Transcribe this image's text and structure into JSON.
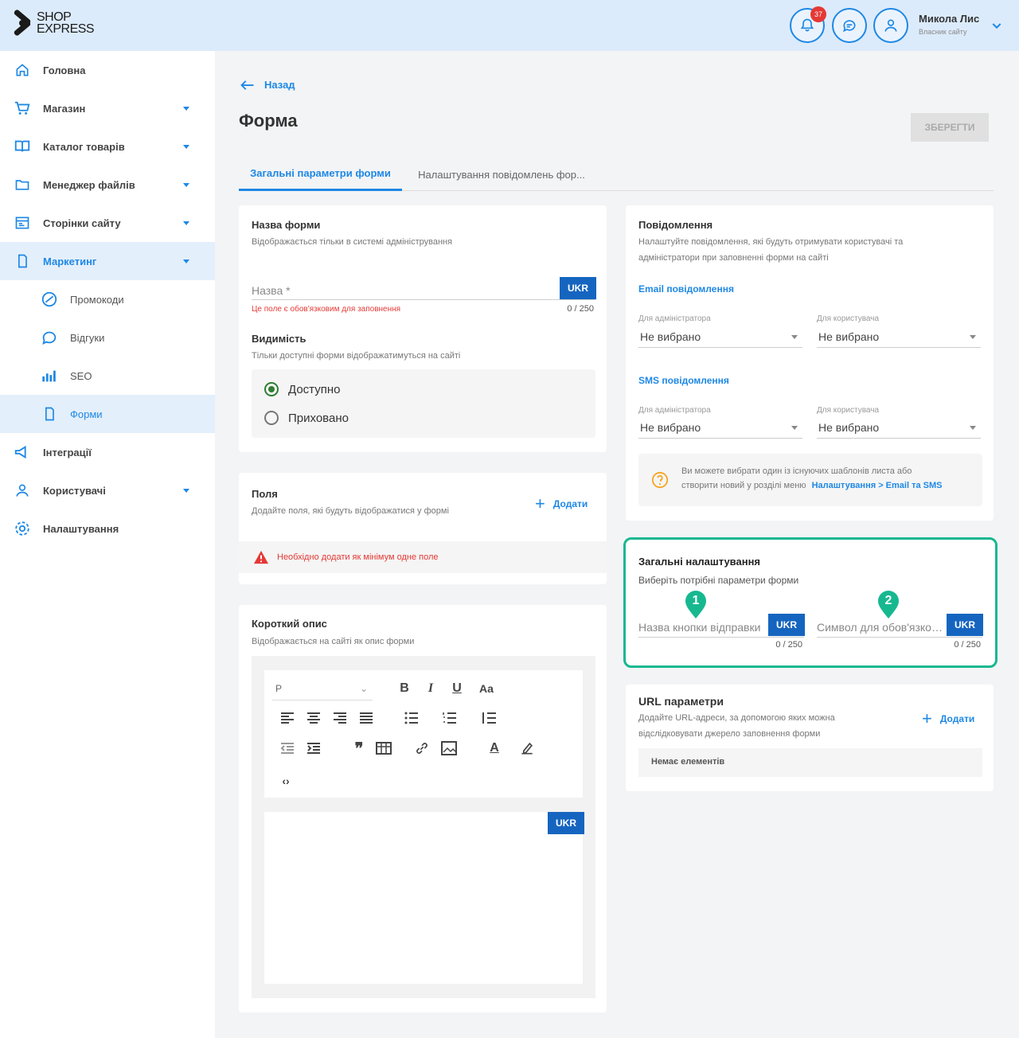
{
  "header": {
    "logo_line1": "SHOP",
    "logo_line2": "EXPRESS",
    "notifications_count": "37",
    "user_name": "Микола Лис",
    "user_role": "Власник сайту",
    "accent": "#1e88e5"
  },
  "sidebar": {
    "items": [
      {
        "label": "Головна",
        "icon": "home-icon"
      },
      {
        "label": "Магазин",
        "icon": "cart-icon"
      },
      {
        "label": "Каталог товарів",
        "icon": "book-icon"
      },
      {
        "label": "Менеджер файлів",
        "icon": "folder-icon"
      },
      {
        "label": "Сторінки сайту",
        "icon": "pages-icon"
      },
      {
        "label": "Маркетинг",
        "icon": "marketing-icon"
      },
      {
        "label": "Промокоди",
        "icon": "promo-icon"
      },
      {
        "label": "Відгуки",
        "icon": "review-icon"
      },
      {
        "label": "SEO",
        "icon": "seo-icon"
      },
      {
        "label": "Форми",
        "icon": "form-icon"
      },
      {
        "label": "Інтеграції",
        "icon": "integration-icon"
      },
      {
        "label": "Користувачі",
        "icon": "users-icon"
      },
      {
        "label": "Налаштування",
        "icon": "gear-icon"
      }
    ]
  },
  "page": {
    "back_label": "Назад",
    "title": "Форма",
    "save_label": "ЗБЕРЕГТИ",
    "tabs": [
      "Загальні параметри форми",
      "Налаштування повідомлень фор..."
    ]
  },
  "form_name": {
    "title": "Назва форми",
    "subtitle": "Відображається тільки в системі адміністрування",
    "placeholder": "Назва *",
    "lang": "UKR",
    "error": "Це поле є обов'язковим для заповнення",
    "counter": "0 / 250",
    "visibility_title": "Видимість",
    "visibility_subtitle": "Тільки доступні форми відображатимуться на сайті",
    "option_available": "Доступно",
    "option_hidden": "Приховано"
  },
  "fields": {
    "title": "Поля",
    "subtitle": "Додайте поля, які будуть відображатися у формі",
    "add_label": "Додати",
    "warning": "Необхідно додати як мінімум одне поле"
  },
  "short_desc": {
    "title": "Короткий опис",
    "subtitle": "Відображається на сайті як опис форми",
    "paragraph_select": "P",
    "lang": "UKR"
  },
  "notifications": {
    "title": "Повідомлення",
    "subtitle_line1": "Налаштуйте повідомлення, які будуть отримувати користувачі та",
    "subtitle_line2": "адміністратори при заповненні форми на сайті",
    "email_title": "Email повідомлення",
    "sms_title": "SMS повідомлення",
    "admin_label": "Для адміністратора",
    "user_label": "Для користувача",
    "not_selected": "Не вибрано",
    "info_line1": "Ви можете вибрати один із існуючих шаблонів листа або",
    "info_line2": "створити новий у розділі меню",
    "info_link": "Налаштування > Email та SMS"
  },
  "general": {
    "title": "Загальні налаштування",
    "subtitle": "Виберіть потрібні параметри форми",
    "button_name_placeholder": "Назва кнопки відправки",
    "required_symbol_placeholder": "Символ для обов'язкового поля",
    "lang": "UKR",
    "counter": "0 / 250",
    "marker1": "1",
    "marker2": "2",
    "highlight_color": "#17b890"
  },
  "url_params": {
    "title": "URL параметри",
    "subtitle_line1": "Додайте URL-адреси, за допомогою яких можна",
    "subtitle_line2": "відслідковувати джерело заповнення форми",
    "add_label": "Додати",
    "empty": "Немає елементів"
  }
}
